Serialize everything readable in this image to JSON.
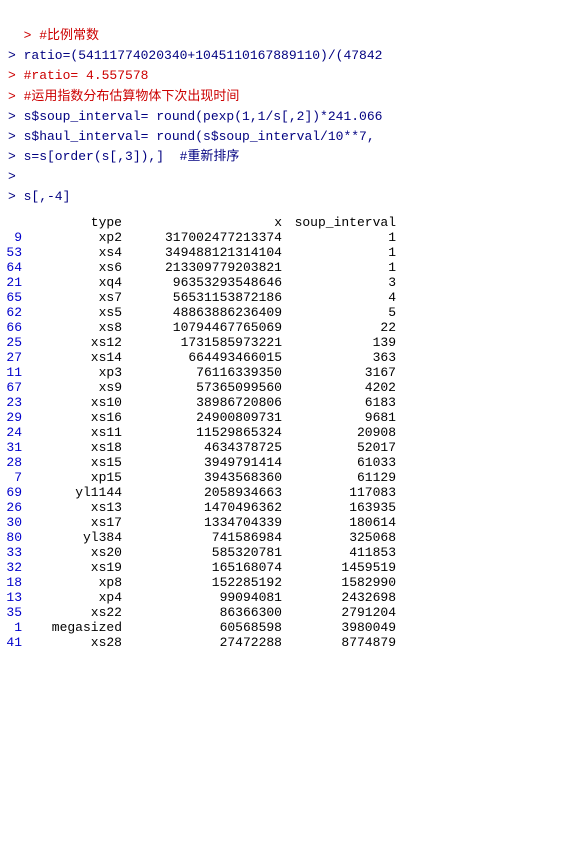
{
  "console": {
    "lines": [
      {
        "type": "comment",
        "text": "> #比例常数"
      },
      {
        "type": "code",
        "text": "> ratio=(54111774020340+1045110167889110)/(47842"
      },
      {
        "type": "comment",
        "text": "> #ratio= 4.557578"
      },
      {
        "type": "comment",
        "text": "> #运用指数分布估算物体下次出现时间"
      },
      {
        "type": "code",
        "text": "> s$soup_interval= round(pexp(1,1/s[,2])*241.066"
      },
      {
        "type": "code",
        "text": "> s$haul_interval= round(s$soup_interval/10**7,"
      },
      {
        "type": "code",
        "text": "> s=s[order(s[,3]),]  #重新排序"
      },
      {
        "type": "blank",
        "text": ">"
      },
      {
        "type": "code",
        "text": "> s[,-4]"
      }
    ],
    "table_header": {
      "rn": "",
      "type": "type",
      "x": "x",
      "soup_interval": "soup_interval"
    },
    "rows": [
      {
        "rn": "9",
        "type": "xp2",
        "x": "317002477213374",
        "soup_interval": "1"
      },
      {
        "rn": "53",
        "type": "xs4",
        "x": "349488121314104",
        "soup_interval": "1"
      },
      {
        "rn": "64",
        "type": "xs6",
        "x": "213309779203821",
        "soup_interval": "1"
      },
      {
        "rn": "21",
        "type": "xq4",
        "x": "96353293548646",
        "soup_interval": "3"
      },
      {
        "rn": "65",
        "type": "xs7",
        "x": "56531153872186",
        "soup_interval": "4"
      },
      {
        "rn": "62",
        "type": "xs5",
        "x": "48863886236409",
        "soup_interval": "5"
      },
      {
        "rn": "66",
        "type": "xs8",
        "x": "10794467765069",
        "soup_interval": "22"
      },
      {
        "rn": "25",
        "type": "xs12",
        "x": "1731585973221",
        "soup_interval": "139"
      },
      {
        "rn": "27",
        "type": "xs14",
        "x": "664493466015",
        "soup_interval": "363"
      },
      {
        "rn": "11",
        "type": "xp3",
        "x": "76116339350",
        "soup_interval": "3167"
      },
      {
        "rn": "67",
        "type": "xs9",
        "x": "57365099560",
        "soup_interval": "4202"
      },
      {
        "rn": "23",
        "type": "xs10",
        "x": "38986720806",
        "soup_interval": "6183"
      },
      {
        "rn": "29",
        "type": "xs16",
        "x": "24900809731",
        "soup_interval": "9681"
      },
      {
        "rn": "24",
        "type": "xs11",
        "x": "11529865324",
        "soup_interval": "20908"
      },
      {
        "rn": "31",
        "type": "xs18",
        "x": "4634378725",
        "soup_interval": "52017"
      },
      {
        "rn": "28",
        "type": "xs15",
        "x": "3949791414",
        "soup_interval": "61033"
      },
      {
        "rn": "7",
        "type": "xp15",
        "x": "3943568360",
        "soup_interval": "61129"
      },
      {
        "rn": "69",
        "type": "yl1144",
        "x": "2058934663",
        "soup_interval": "117083"
      },
      {
        "rn": "26",
        "type": "xs13",
        "x": "1470496362",
        "soup_interval": "163935"
      },
      {
        "rn": "30",
        "type": "xs17",
        "x": "1334704339",
        "soup_interval": "180614"
      },
      {
        "rn": "80",
        "type": "yl384",
        "x": "741586984",
        "soup_interval": "325068"
      },
      {
        "rn": "33",
        "type": "xs20",
        "x": "585320781",
        "soup_interval": "411853"
      },
      {
        "rn": "32",
        "type": "xs19",
        "x": "165168074",
        "soup_interval": "1459519"
      },
      {
        "rn": "18",
        "type": "xp8",
        "x": "152285192",
        "soup_interval": "1582990"
      },
      {
        "rn": "13",
        "type": "xp4",
        "x": "99094081",
        "soup_interval": "2432698"
      },
      {
        "rn": "35",
        "type": "xs22",
        "x": "86366300",
        "soup_interval": "2791204"
      },
      {
        "rn": "1",
        "type": "megasized",
        "x": "60568598",
        "soup_interval": "3980049"
      },
      {
        "rn": "41",
        "type": "xs28",
        "x": "27472288",
        "soup_interval": "8774879"
      }
    ]
  }
}
